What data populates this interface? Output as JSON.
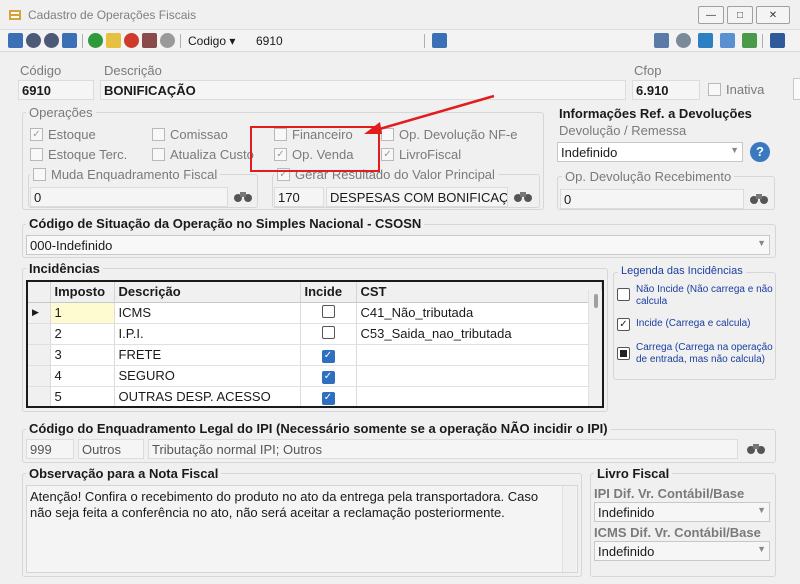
{
  "window": {
    "title": "Cadastro de Operações Fiscais",
    "min_glyph": "—",
    "max_glyph": "□",
    "close_glyph": "✕"
  },
  "toolbar": {
    "search_field_label": "Codigo",
    "search_field_arrow": "▾",
    "search_value": "6910"
  },
  "header": {
    "codigo_label": "Código",
    "codigo_value": "6910",
    "descricao_label": "Descrição",
    "descricao_value": "BONIFICAÇÃO",
    "cfop_label": "Cfop",
    "cfop_value": "6.910",
    "inativa_label": "Inativa"
  },
  "operacoes": {
    "title": "Operações",
    "estoque": "Estoque",
    "estoque_terc": "Estoque Terc.",
    "comissao": "Comissao",
    "atualiza_custo": "Atualiza Custo",
    "financeiro": "Financeiro",
    "op_venda": "Op. Venda",
    "op_devolucao_nfe": "Op. Devolução NF-e",
    "livro_fiscal": "LivroFiscal",
    "muda_enquadramento": "Muda Enquadramento Fiscal",
    "muda_enq_value": "0",
    "gerar_resultado": "Gerar Resultado do Valor Principal",
    "gerar_code": "170",
    "gerar_desc": "DESPESAS COM BONIFICAÇÃ",
    "checkmark": "✓"
  },
  "devolucoes": {
    "title": "Informações Ref. a Devoluções",
    "devolucao_remessa_label": "Devolução / Remessa",
    "devolucao_value": "Indefinido",
    "help_glyph": "?",
    "op_devolucao_recebimento_label": "Op. Devolução Recebimento",
    "op_devolucao_recebimento_value": "0"
  },
  "csosn": {
    "title": "Código de Situação da Operação no Simples Nacional - CSOSN",
    "value": "000-Indefinido"
  },
  "incidencias": {
    "title": "Incidências",
    "columns": [
      "Imposto",
      "Descrição",
      "Incide",
      "CST"
    ],
    "current_row_marker": "▶",
    "rows": [
      {
        "imposto": "1",
        "descricao": "ICMS",
        "incide": false,
        "cst": "C41_Não_tributada"
      },
      {
        "imposto": "2",
        "descricao": "I.P.I.",
        "incide": false,
        "cst": "C53_Saida_nao_tributada"
      },
      {
        "imposto": "3",
        "descricao": "FRETE",
        "incide": true,
        "cst": ""
      },
      {
        "imposto": "4",
        "descricao": "SEGURO",
        "incide": true,
        "cst": ""
      },
      {
        "imposto": "5",
        "descricao": "OUTRAS DESP. ACESSO",
        "incide": true,
        "cst": ""
      }
    ]
  },
  "legenda": {
    "title": "Legenda das Incidências",
    "nao_incide": "Não Incide (Não carrega e não calcula",
    "incide": "Incide (Carrega e calcula)",
    "carrega": "Carrega (Carrega na operação de entrada, mas não calcula)"
  },
  "enquadramento": {
    "title": "Código do Enquadramento Legal do IPI (Necessário somente se a operação NÃO incidir o IPI)",
    "code": "999",
    "group": "Outros",
    "desc": "Tributação normal IPI; Outros"
  },
  "observacao": {
    "title": "Observação para a Nota Fiscal",
    "text": "Atenção! Confira o recebimento do produto no ato da entrega pela transportadora. Caso não seja feita a conferência no ato, não será aceitar a reclamação posteriormente."
  },
  "livro_fiscal": {
    "title": "Livro Fiscal",
    "ipi_label": "IPI Dif. Vr. Contábil/Base",
    "ipi_value": "Indefinido",
    "icms_label": "ICMS Dif. Vr. Contábil/Base",
    "icms_value": "Indefinido"
  },
  "colors": {
    "annotation_red": "#e21d1d",
    "accent_blue": "#2f6fbf",
    "legend_blue": "#1a3fa0"
  }
}
